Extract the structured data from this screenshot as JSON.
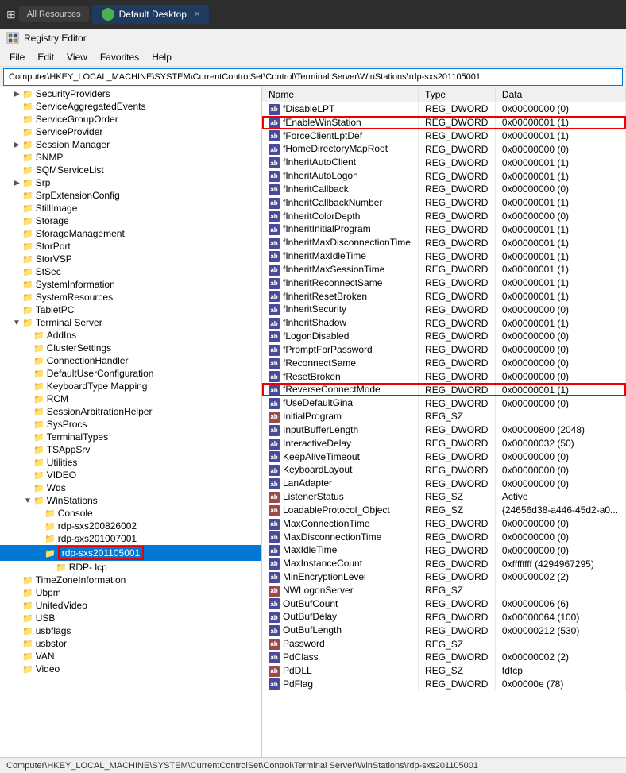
{
  "topbar": {
    "apps_label": "All Resources",
    "tab_label": "Default Desktop",
    "close_label": "×"
  },
  "window": {
    "title": "Registry Editor"
  },
  "menus": [
    "File",
    "Edit",
    "View",
    "Favorites",
    "Help"
  ],
  "address": "Computer\\HKEY_LOCAL_MACHINE\\SYSTEM\\CurrentControlSet\\Control\\Terminal Server\\WinStations\\rdp-sxs201105001",
  "tree": {
    "items": [
      {
        "label": "SecurityProviders",
        "level": 2,
        "expanded": false,
        "hasChildren": true,
        "selected": false
      },
      {
        "label": "ServiceAggregatedEvents",
        "level": 2,
        "expanded": false,
        "hasChildren": false,
        "selected": false
      },
      {
        "label": "ServiceGroupOrder",
        "level": 2,
        "expanded": false,
        "hasChildren": false,
        "selected": false
      },
      {
        "label": "ServiceProvider",
        "level": 2,
        "expanded": false,
        "hasChildren": false,
        "selected": false
      },
      {
        "label": "Session Manager",
        "level": 2,
        "expanded": false,
        "hasChildren": true,
        "selected": false
      },
      {
        "label": "SNMP",
        "level": 2,
        "expanded": false,
        "hasChildren": false,
        "selected": false
      },
      {
        "label": "SQMServiceList",
        "level": 2,
        "expanded": false,
        "hasChildren": false,
        "selected": false
      },
      {
        "label": "Srp",
        "level": 2,
        "expanded": false,
        "hasChildren": true,
        "selected": false
      },
      {
        "label": "SrpExtensionConfig",
        "level": 2,
        "expanded": false,
        "hasChildren": false,
        "selected": false
      },
      {
        "label": "StillImage",
        "level": 2,
        "expanded": false,
        "hasChildren": false,
        "selected": false
      },
      {
        "label": "Storage",
        "level": 2,
        "expanded": false,
        "hasChildren": false,
        "selected": false
      },
      {
        "label": "StorageManagement",
        "level": 2,
        "expanded": false,
        "hasChildren": false,
        "selected": false
      },
      {
        "label": "StorPort",
        "level": 2,
        "expanded": false,
        "hasChildren": false,
        "selected": false
      },
      {
        "label": "StorVSP",
        "level": 2,
        "expanded": false,
        "hasChildren": false,
        "selected": false
      },
      {
        "label": "StSec",
        "level": 2,
        "expanded": false,
        "hasChildren": false,
        "selected": false
      },
      {
        "label": "SystemInformation",
        "level": 2,
        "expanded": false,
        "hasChildren": false,
        "selected": false
      },
      {
        "label": "SystemResources",
        "level": 2,
        "expanded": false,
        "hasChildren": false,
        "selected": false
      },
      {
        "label": "TabletPC",
        "level": 2,
        "expanded": false,
        "hasChildren": false,
        "selected": false
      },
      {
        "label": "Terminal Server",
        "level": 2,
        "expanded": true,
        "hasChildren": true,
        "selected": false
      },
      {
        "label": "AddIns",
        "level": 3,
        "expanded": false,
        "hasChildren": false,
        "selected": false
      },
      {
        "label": "ClusterSettings",
        "level": 3,
        "expanded": false,
        "hasChildren": false,
        "selected": false
      },
      {
        "label": "ConnectionHandler",
        "level": 3,
        "expanded": false,
        "hasChildren": false,
        "selected": false
      },
      {
        "label": "DefaultUserConfiguration",
        "level": 3,
        "expanded": false,
        "hasChildren": false,
        "selected": false
      },
      {
        "label": "KeyboardType Mapping",
        "level": 3,
        "expanded": false,
        "hasChildren": false,
        "selected": false
      },
      {
        "label": "RCM",
        "level": 3,
        "expanded": false,
        "hasChildren": false,
        "selected": false
      },
      {
        "label": "SessionArbitrationHelper",
        "level": 3,
        "expanded": false,
        "hasChildren": false,
        "selected": false
      },
      {
        "label": "SysProcs",
        "level": 3,
        "expanded": false,
        "hasChildren": false,
        "selected": false
      },
      {
        "label": "TerminalTypes",
        "level": 3,
        "expanded": false,
        "hasChildren": false,
        "selected": false
      },
      {
        "label": "TSAppSrv",
        "level": 3,
        "expanded": false,
        "hasChildren": false,
        "selected": false
      },
      {
        "label": "Utilities",
        "level": 3,
        "expanded": false,
        "hasChildren": false,
        "selected": false
      },
      {
        "label": "VIDEO",
        "level": 3,
        "expanded": false,
        "hasChildren": false,
        "selected": false
      },
      {
        "label": "Wds",
        "level": 3,
        "expanded": false,
        "hasChildren": false,
        "selected": false
      },
      {
        "label": "WinStations",
        "level": 3,
        "expanded": true,
        "hasChildren": true,
        "selected": false
      },
      {
        "label": "Console",
        "level": 4,
        "expanded": false,
        "hasChildren": false,
        "selected": false
      },
      {
        "label": "rdp-sxs200826002",
        "level": 4,
        "expanded": false,
        "hasChildren": false,
        "selected": false
      },
      {
        "label": "rdp-sxs201007001",
        "level": 4,
        "expanded": false,
        "hasChildren": false,
        "selected": false
      },
      {
        "label": "rdp-sxs201105001",
        "level": 4,
        "expanded": false,
        "hasChildren": false,
        "selected": true,
        "highlight": true
      },
      {
        "label": "RDP- lcp",
        "level": 5,
        "expanded": false,
        "hasChildren": false,
        "selected": false
      },
      {
        "label": "TimeZoneInformation",
        "level": 2,
        "expanded": false,
        "hasChildren": false,
        "selected": false
      },
      {
        "label": "Ubpm",
        "level": 2,
        "expanded": false,
        "hasChildren": false,
        "selected": false
      },
      {
        "label": "UnitedVideo",
        "level": 2,
        "expanded": false,
        "hasChildren": false,
        "selected": false
      },
      {
        "label": "USB",
        "level": 2,
        "expanded": false,
        "hasChildren": false,
        "selected": false
      },
      {
        "label": "usbflags",
        "level": 2,
        "expanded": false,
        "hasChildren": false,
        "selected": false
      },
      {
        "label": "usbstor",
        "level": 2,
        "expanded": false,
        "hasChildren": false,
        "selected": false
      },
      {
        "label": "VAN",
        "level": 2,
        "expanded": false,
        "hasChildren": false,
        "selected": false
      },
      {
        "label": "Video",
        "level": 2,
        "expanded": false,
        "hasChildren": false,
        "selected": false
      }
    ]
  },
  "columns": [
    "Name",
    "Type",
    "Data"
  ],
  "registry_entries": [
    {
      "name": "fDisableLPT",
      "type": "REG_DWORD",
      "data": "0x00000000 (0)",
      "icon": "dword",
      "selected": false,
      "highlight": false
    },
    {
      "name": "fEnableWinStation",
      "type": "REG_DWORD",
      "data": "0x00000001 (1)",
      "icon": "dword",
      "selected": false,
      "highlight": true
    },
    {
      "name": "fForceClientLptDef",
      "type": "REG_DWORD",
      "data": "0x00000001 (1)",
      "icon": "dword",
      "selected": false,
      "highlight": false
    },
    {
      "name": "fHomeDirectoryMapRoot",
      "type": "REG_DWORD",
      "data": "0x00000000 (0)",
      "icon": "dword",
      "selected": false,
      "highlight": false
    },
    {
      "name": "fInheritAutoClient",
      "type": "REG_DWORD",
      "data": "0x00000001 (1)",
      "icon": "dword",
      "selected": false,
      "highlight": false
    },
    {
      "name": "fInheritAutoLogon",
      "type": "REG_DWORD",
      "data": "0x00000001 (1)",
      "icon": "dword",
      "selected": false,
      "highlight": false
    },
    {
      "name": "fInheritCallback",
      "type": "REG_DWORD",
      "data": "0x00000000 (0)",
      "icon": "dword",
      "selected": false,
      "highlight": false
    },
    {
      "name": "fInheritCallbackNumber",
      "type": "REG_DWORD",
      "data": "0x00000001 (1)",
      "icon": "dword",
      "selected": false,
      "highlight": false
    },
    {
      "name": "fInheritColorDepth",
      "type": "REG_DWORD",
      "data": "0x00000000 (0)",
      "icon": "dword",
      "selected": false,
      "highlight": false
    },
    {
      "name": "fInheritInitialProgram",
      "type": "REG_DWORD",
      "data": "0x00000001 (1)",
      "icon": "dword",
      "selected": false,
      "highlight": false
    },
    {
      "name": "fInheritMaxDisconnectionTime",
      "type": "REG_DWORD",
      "data": "0x00000001 (1)",
      "icon": "dword",
      "selected": false,
      "highlight": false
    },
    {
      "name": "fInheritMaxIdleTime",
      "type": "REG_DWORD",
      "data": "0x00000001 (1)",
      "icon": "dword",
      "selected": false,
      "highlight": false
    },
    {
      "name": "fInheritMaxSessionTime",
      "type": "REG_DWORD",
      "data": "0x00000001 (1)",
      "icon": "dword",
      "selected": false,
      "highlight": false
    },
    {
      "name": "fInheritReconnectSame",
      "type": "REG_DWORD",
      "data": "0x00000001 (1)",
      "icon": "dword",
      "selected": false,
      "highlight": false
    },
    {
      "name": "fInheritResetBroken",
      "type": "REG_DWORD",
      "data": "0x00000001 (1)",
      "icon": "dword",
      "selected": false,
      "highlight": false
    },
    {
      "name": "fInheritSecurity",
      "type": "REG_DWORD",
      "data": "0x00000000 (0)",
      "icon": "dword",
      "selected": false,
      "highlight": false
    },
    {
      "name": "fInheritShadow",
      "type": "REG_DWORD",
      "data": "0x00000001 (1)",
      "icon": "dword",
      "selected": false,
      "highlight": false
    },
    {
      "name": "fLogonDisabled",
      "type": "REG_DWORD",
      "data": "0x00000000 (0)",
      "icon": "dword",
      "selected": false,
      "highlight": false
    },
    {
      "name": "fPromptForPassword",
      "type": "REG_DWORD",
      "data": "0x00000000 (0)",
      "icon": "dword",
      "selected": false,
      "highlight": false
    },
    {
      "name": "fReconnectSame",
      "type": "REG_DWORD",
      "data": "0x00000000 (0)",
      "icon": "dword",
      "selected": false,
      "highlight": false
    },
    {
      "name": "fResetBroken",
      "type": "REG_DWORD",
      "data": "0x00000000 (0)",
      "icon": "dword",
      "selected": false,
      "highlight": false
    },
    {
      "name": "fReverseConnectMode",
      "type": "REG_DWORD",
      "data": "0x00000001 (1)",
      "icon": "dword",
      "selected": false,
      "highlight": true
    },
    {
      "name": "fUseDefaultGina",
      "type": "REG_DWORD",
      "data": "0x00000000 (0)",
      "icon": "dword",
      "selected": false,
      "highlight": false
    },
    {
      "name": "InitialProgram",
      "type": "REG_SZ",
      "data": "",
      "icon": "sz",
      "selected": false,
      "highlight": false
    },
    {
      "name": "InputBufferLength",
      "type": "REG_DWORD",
      "data": "0x00000800 (2048)",
      "icon": "dword",
      "selected": false,
      "highlight": false
    },
    {
      "name": "InteractiveDelay",
      "type": "REG_DWORD",
      "data": "0x00000032 (50)",
      "icon": "dword",
      "selected": false,
      "highlight": false
    },
    {
      "name": "KeepAliveTimeout",
      "type": "REG_DWORD",
      "data": "0x00000000 (0)",
      "icon": "dword",
      "selected": false,
      "highlight": false
    },
    {
      "name": "KeyboardLayout",
      "type": "REG_DWORD",
      "data": "0x00000000 (0)",
      "icon": "dword",
      "selected": false,
      "highlight": false
    },
    {
      "name": "LanAdapter",
      "type": "REG_DWORD",
      "data": "0x00000000 (0)",
      "icon": "dword",
      "selected": false,
      "highlight": false
    },
    {
      "name": "ListenerStatus",
      "type": "REG_SZ",
      "data": "Active",
      "icon": "sz",
      "selected": false,
      "highlight": false
    },
    {
      "name": "LoadableProtocol_Object",
      "type": "REG_SZ",
      "data": "{24656d38-a446-45d2-a0...",
      "icon": "sz",
      "selected": false,
      "highlight": false
    },
    {
      "name": "MaxConnectionTime",
      "type": "REG_DWORD",
      "data": "0x00000000 (0)",
      "icon": "dword",
      "selected": false,
      "highlight": false
    },
    {
      "name": "MaxDisconnectionTime",
      "type": "REG_DWORD",
      "data": "0x00000000 (0)",
      "icon": "dword",
      "selected": false,
      "highlight": false
    },
    {
      "name": "MaxIdleTime",
      "type": "REG_DWORD",
      "data": "0x00000000 (0)",
      "icon": "dword",
      "selected": false,
      "highlight": false
    },
    {
      "name": "MaxInstanceCount",
      "type": "REG_DWORD",
      "data": "0xffffffff (4294967295)",
      "icon": "dword",
      "selected": false,
      "highlight": false
    },
    {
      "name": "MinEncryptionLevel",
      "type": "REG_DWORD",
      "data": "0x00000002 (2)",
      "icon": "dword",
      "selected": false,
      "highlight": false
    },
    {
      "name": "NWLogonServer",
      "type": "REG_SZ",
      "data": "",
      "icon": "sz",
      "selected": false,
      "highlight": false
    },
    {
      "name": "OutBufCount",
      "type": "REG_DWORD",
      "data": "0x00000006 (6)",
      "icon": "dword",
      "selected": false,
      "highlight": false
    },
    {
      "name": "OutBufDelay",
      "type": "REG_DWORD",
      "data": "0x00000064 (100)",
      "icon": "dword",
      "selected": false,
      "highlight": false
    },
    {
      "name": "OutBufLength",
      "type": "REG_DWORD",
      "data": "0x00000212 (530)",
      "icon": "dword",
      "selected": false,
      "highlight": false
    },
    {
      "name": "Password",
      "type": "REG_SZ",
      "data": "",
      "icon": "sz",
      "selected": false,
      "highlight": false
    },
    {
      "name": "PdClass",
      "type": "REG_DWORD",
      "data": "0x00000002 (2)",
      "icon": "dword",
      "selected": false,
      "highlight": false
    },
    {
      "name": "PdDLL",
      "type": "REG_SZ",
      "data": "tdtcp",
      "icon": "sz",
      "selected": false,
      "highlight": false
    },
    {
      "name": "PdFlag",
      "type": "REG_DWORD",
      "data": "0x00000e (78)",
      "icon": "dword",
      "selected": false,
      "highlight": false
    }
  ]
}
